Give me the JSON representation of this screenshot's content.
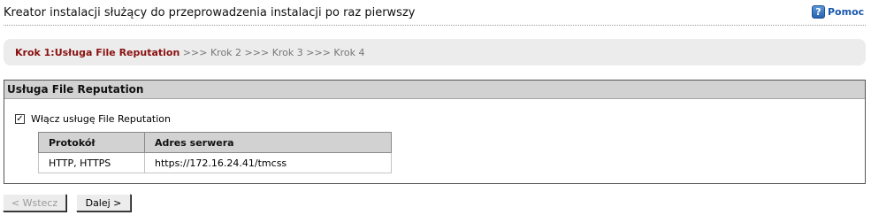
{
  "header": {
    "title": "Kreator instalacji służący do przeprowadzenia instalacji po raz pierwszy",
    "help_icon": "help-question-icon",
    "help_label": "Pomoc"
  },
  "steps": {
    "current": "Krok 1:Usługa File Reputation",
    "rest": [
      " >>> Krok 2",
      " >>> Krok 3",
      " >>> Krok 4"
    ]
  },
  "panel": {
    "title": "Usługa File Reputation",
    "checkbox_label": "Włącz usługę File Reputation",
    "checkbox_checked": true,
    "table": {
      "headers": [
        "Protokół",
        "Adres serwera"
      ],
      "rows": [
        [
          "HTTP, HTTPS",
          "https://172.16.24.41/tmcss"
        ]
      ]
    }
  },
  "buttons": {
    "back_label": "< Wstecz",
    "back_enabled": false,
    "next_label": "Dalej >"
  }
}
